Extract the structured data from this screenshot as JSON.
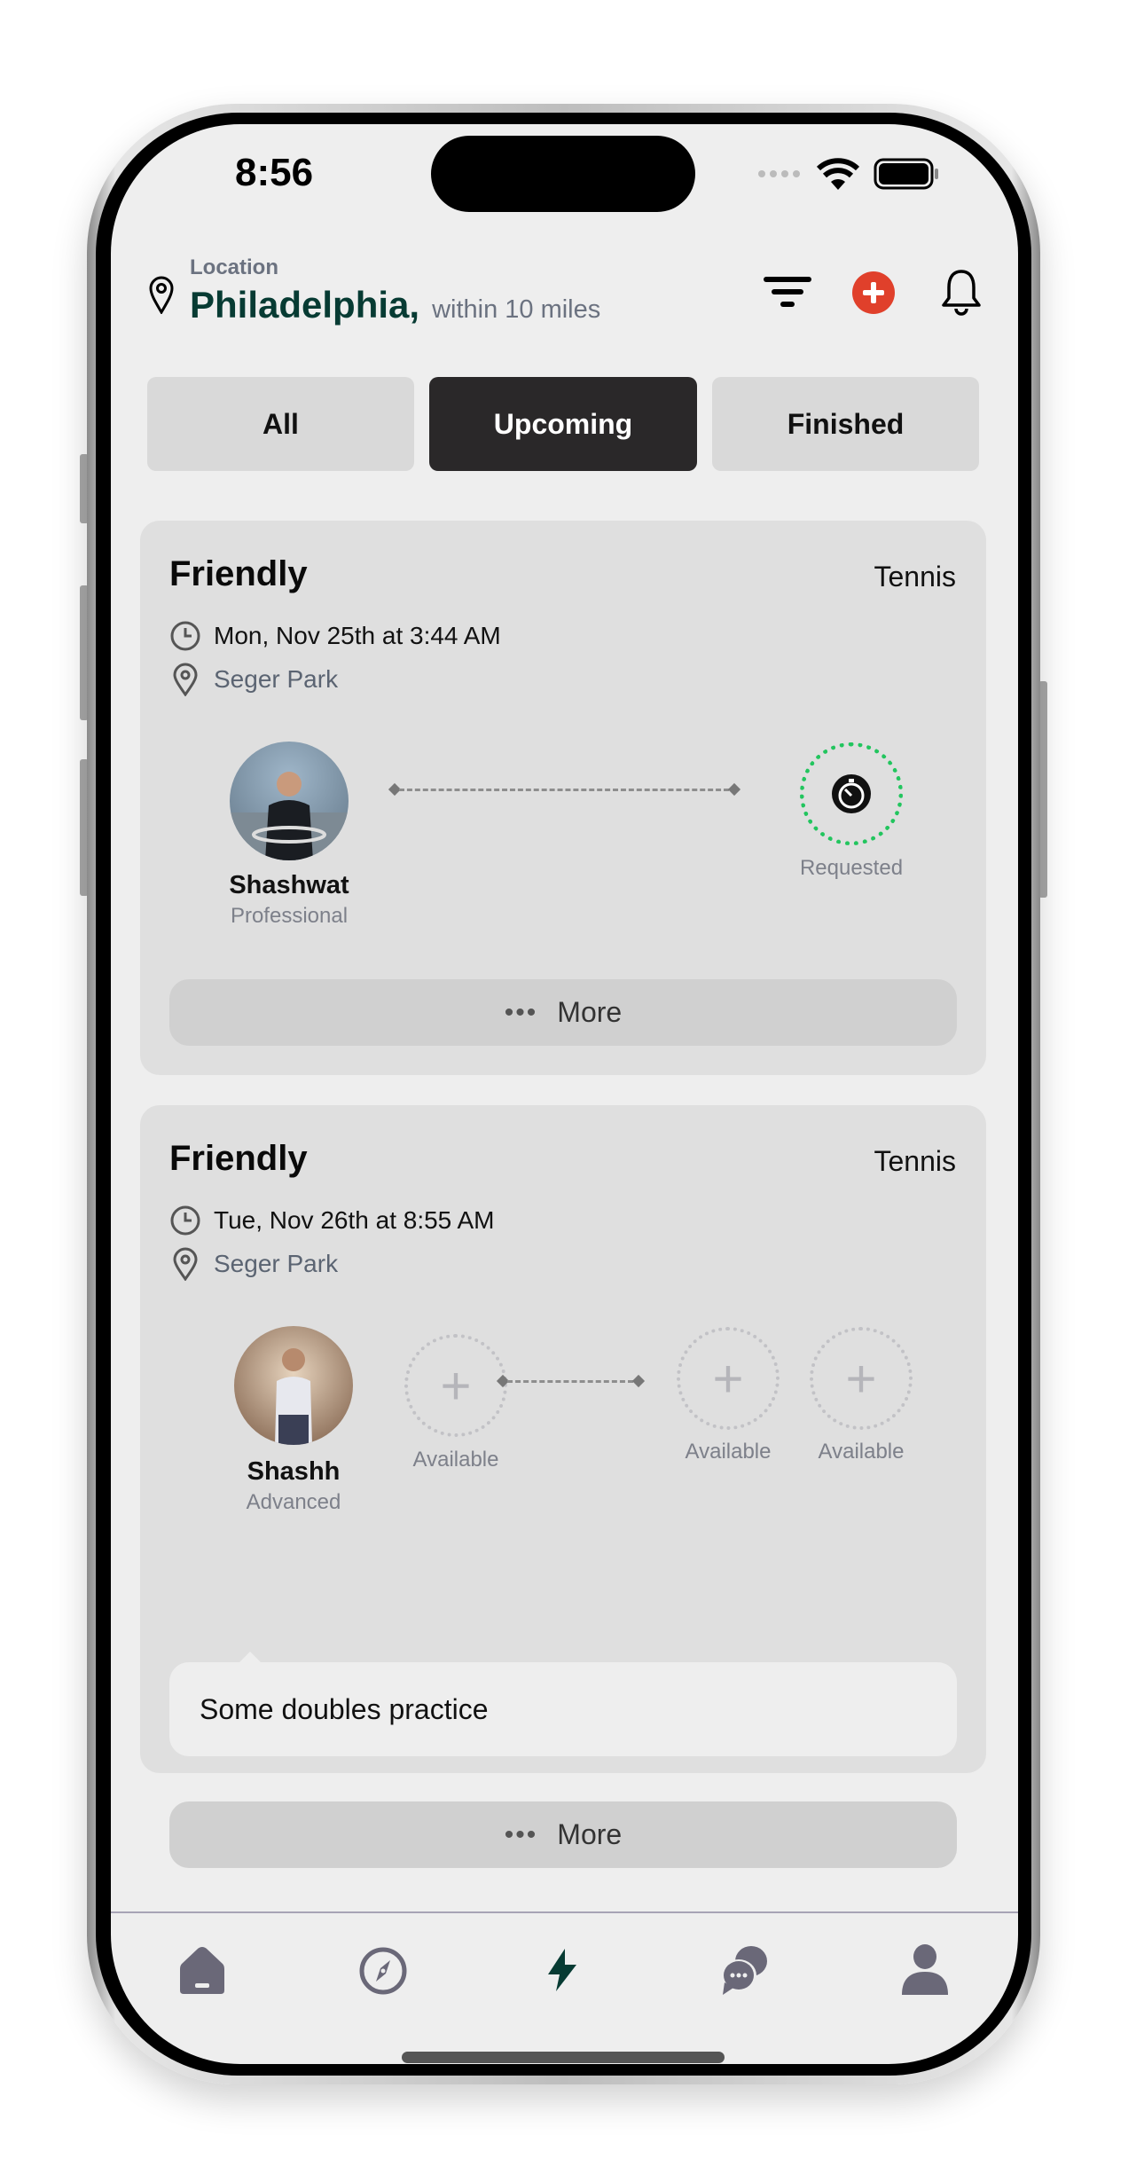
{
  "status_bar": {
    "time": "8:56"
  },
  "header": {
    "location_label": "Location",
    "city": "Philadelphia,",
    "radius": "within 10 miles",
    "icons": [
      "filter-icon",
      "add-icon",
      "bell-icon"
    ],
    "accent_color": "#073b33",
    "add_color": "#e0402b"
  },
  "tabs": [
    {
      "label": "All",
      "active": false
    },
    {
      "label": "Upcoming",
      "active": true
    },
    {
      "label": "Finished",
      "active": false
    }
  ],
  "matches": [
    {
      "type": "Friendly",
      "sport": "Tennis",
      "datetime": "Mon, Nov 25th at 3:44 AM",
      "place": "Seger Park",
      "player": {
        "name": "Shashwat",
        "level": "Professional"
      },
      "opponent_status": "Requested",
      "more_label": "More"
    },
    {
      "type": "Friendly",
      "sport": "Tennis",
      "datetime": "Tue, Nov 26th at 8:55 AM",
      "place": "Seger Park",
      "player": {
        "name": "Shashh",
        "level": "Advanced"
      },
      "slots": [
        "Available",
        "Available",
        "Available"
      ],
      "note": "Some doubles practice",
      "more_label": "More"
    }
  ],
  "bottom_nav": {
    "items": [
      "home-icon",
      "compass-icon",
      "bolt-icon",
      "chat-icon",
      "profile-icon"
    ],
    "active": "bolt-icon"
  }
}
